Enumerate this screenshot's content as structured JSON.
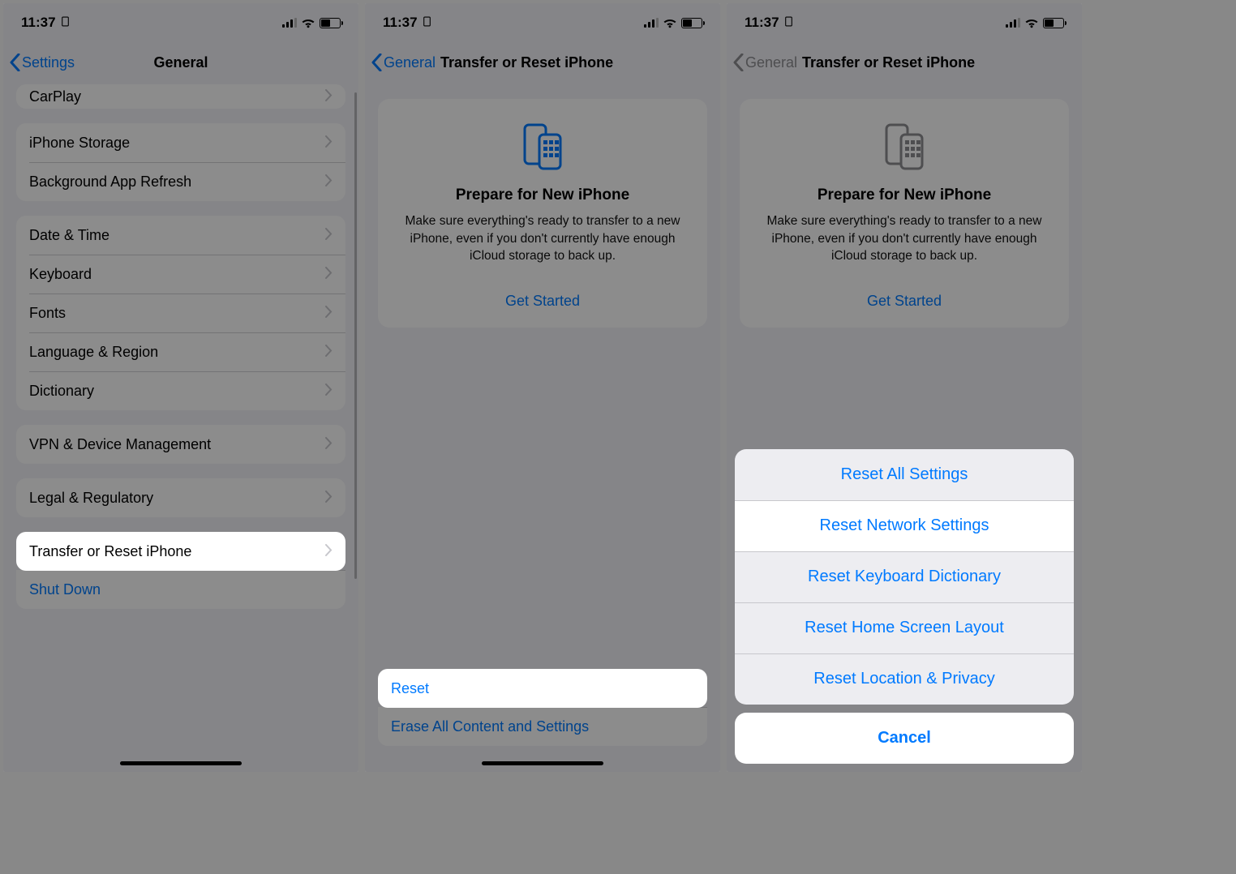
{
  "statusbar": {
    "time": "11:37"
  },
  "screen1": {
    "nav": {
      "back": "Settings",
      "title": "General"
    },
    "group0": {
      "item0": "CarPlay"
    },
    "group1": {
      "item0": "iPhone Storage",
      "item1": "Background App Refresh"
    },
    "group2": {
      "item0": "Date & Time",
      "item1": "Keyboard",
      "item2": "Fonts",
      "item3": "Language & Region",
      "item4": "Dictionary"
    },
    "group3": {
      "item0": "VPN & Device Management"
    },
    "group4": {
      "item0": "Legal & Regulatory"
    },
    "group5": {
      "item0": "Transfer or Reset iPhone",
      "item1": "Shut Down"
    }
  },
  "screen2": {
    "nav": {
      "back": "General",
      "title": "Transfer or Reset iPhone"
    },
    "card": {
      "title": "Prepare for New iPhone",
      "desc": "Make sure everything's ready to transfer to a new iPhone, even if you don't currently have enough iCloud storage to back up.",
      "link": "Get Started"
    },
    "bottom": {
      "reset": "Reset",
      "erase": "Erase All Content and Settings"
    }
  },
  "screen3": {
    "nav": {
      "back": "General",
      "title": "Transfer or Reset iPhone"
    },
    "card": {
      "title": "Prepare for New iPhone",
      "desc": "Make sure everything's ready to transfer to a new iPhone, even if you don't currently have enough iCloud storage to back up.",
      "link": "Get Started"
    },
    "sheet": {
      "item0": "Reset All Settings",
      "item1": "Reset Network Settings",
      "item2": "Reset Keyboard Dictionary",
      "item3": "Reset Home Screen Layout",
      "item4": "Reset Location & Privacy",
      "cancel": "Cancel"
    }
  },
  "colors": {
    "accent": "#007aff"
  }
}
